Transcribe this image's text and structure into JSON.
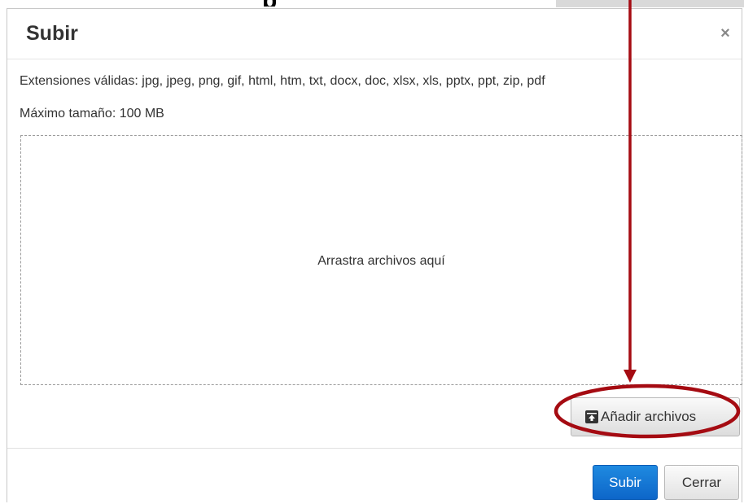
{
  "dialog": {
    "title": "Subir",
    "close_symbol": "×",
    "extensions_text": "Extensiones válidas: jpg, jpeg, png, gif, html, htm, txt, docx, doc, xlsx, xls, pptx, ppt, zip, pdf",
    "max_size_text": "Máximo tamaño: 100 MB",
    "drop_zone_text": "Arrastra archivos aquí",
    "add_files_label": "Añadir archivos"
  },
  "footer": {
    "submit_label": "Subir",
    "close_label": "Cerrar"
  },
  "icons": {
    "close": "close-icon",
    "add_files": "upload-icon"
  },
  "colors": {
    "primary": "#0d66c9",
    "annotation": "#a50b12"
  }
}
